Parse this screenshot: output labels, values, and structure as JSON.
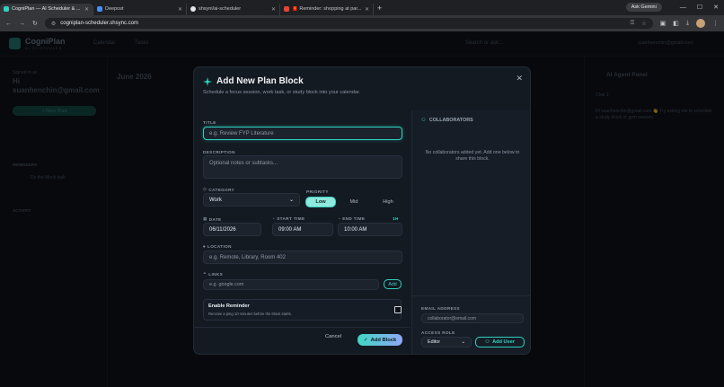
{
  "browser": {
    "tabs": [
      {
        "title": "CogniPlan — AI Scheduler & ...",
        "active": true,
        "color": "#2fd3c0"
      },
      {
        "title": "Deepost",
        "active": false,
        "color": "#4a8ef0"
      },
      {
        "title": "shsyni/ai-scheduler",
        "active": false,
        "color": "#e6e6e6"
      },
      {
        "title": "🧧 Reminder: shopping at par...",
        "active": false,
        "color": "#ea4335"
      }
    ],
    "new_tab": "+",
    "ask_gemini": "Ask Gemini",
    "url": "cogniplan-scheduler.shsync.com"
  },
  "app": {
    "logo_name": "CogniPlan",
    "logo_sub": "AI SCHEDULER",
    "nav": [
      "Calendar",
      "Tasks"
    ],
    "search_placeholder": "Search or ask...",
    "user_email": "suanhenchin@gmail.com",
    "sidebar": {
      "signed_in_label": "Signed in as",
      "hi": "Hi",
      "email": "suanhenchin@gmail.com",
      "new_plan": "+ New Plan",
      "reminders_label": "REMINDERS",
      "reminder_item": "Do the Mock task",
      "activity_label": "ACTIVITY"
    },
    "calendar": {
      "month": "June 2026"
    },
    "right_panel": {
      "title": "AI Agent Panel",
      "chat_label": "Chat 1",
      "greeting": "Hi suanhenchin@gmail.com 👋 Try asking me to schedule a study block or gym session."
    }
  },
  "modal": {
    "title": "Add New Plan Block",
    "subtitle": "Schedule a focus session, work task, or study block into your calendar.",
    "close": "✕",
    "title_label": "TITLE",
    "title_placeholder": "e.g. Review FYP Literature",
    "description_label": "DESCRIPTION",
    "description_placeholder": "Optional notes or subtasks...",
    "category_label": "CATEGORY",
    "category_value": "Work",
    "priority_label": "PRIORITY",
    "priority_options": [
      "Low",
      "Mid",
      "High"
    ],
    "priority_selected": "Low",
    "date_label": "DATE",
    "date_value": "06/11/2026",
    "start_label": "START TIME",
    "start_value": "09:00 AM",
    "end_label": "END TIME",
    "end_badge": "1H",
    "end_value": "10:00 AM",
    "location_label": "LOCATION",
    "location_placeholder": "e.g. Remote, Library, Room 402",
    "links_label": "LINKS",
    "links_placeholder": "e.g. google.com",
    "links_add": "Add",
    "reminder_title": "Enable Reminder",
    "reminder_desc": "Receive a ping 10 minutes before the block starts.",
    "cancel": "Cancel",
    "add_block": "Add Block",
    "collab": {
      "header": "COLLABORATORS",
      "empty": "No collaborators added yet. Add one below to share this block.",
      "email_label": "EMAIL ADDRESS",
      "email_placeholder": "collaborator@email.com",
      "role_label": "ACCESS ROLE",
      "role_value": "Editor",
      "add_user": "Add User"
    }
  },
  "colors": {
    "accent": "#2fd3c0",
    "modal_bg": "#141a22"
  }
}
